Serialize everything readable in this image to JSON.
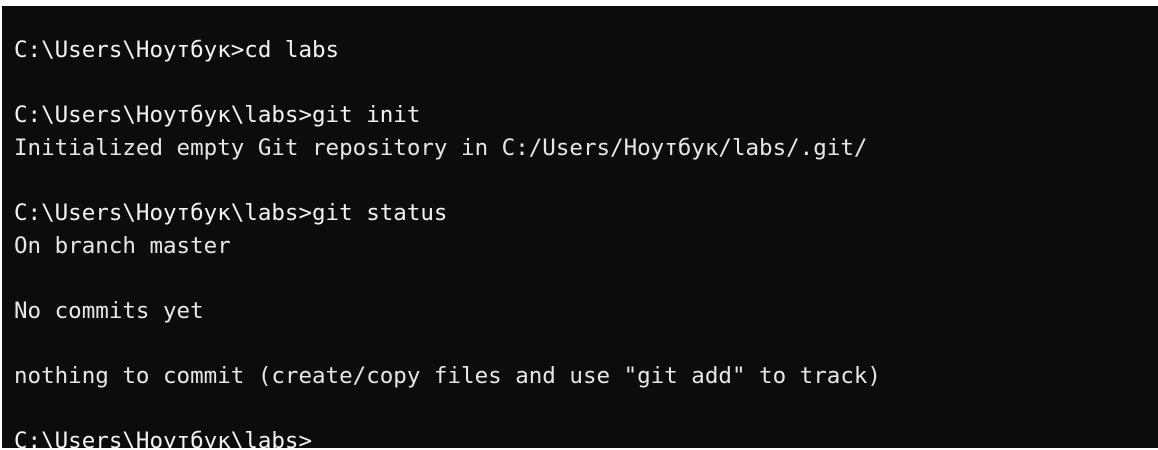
{
  "terminal": {
    "lines": [
      {
        "text": "C:\\Users\\Ноутбук>cd labs",
        "kind": "prompt"
      },
      {
        "text": "",
        "kind": "blank"
      },
      {
        "text": "C:\\Users\\Ноутбук\\labs>git init",
        "kind": "prompt"
      },
      {
        "text": "Initialized empty Git repository in C:/Users/Ноутбук/labs/.git/",
        "kind": "output"
      },
      {
        "text": "",
        "kind": "blank"
      },
      {
        "text": "C:\\Users\\Ноутбук\\labs>git status",
        "kind": "prompt"
      },
      {
        "text": "On branch master",
        "kind": "output"
      },
      {
        "text": "",
        "kind": "blank"
      },
      {
        "text": "No commits yet",
        "kind": "output"
      },
      {
        "text": "",
        "kind": "blank"
      },
      {
        "text": "nothing to commit (create/copy files and use \"git add\" to track)",
        "kind": "output"
      },
      {
        "text": "",
        "kind": "blank"
      },
      {
        "text": "C:\\Users\\Ноутбук\\labs>",
        "kind": "prompt"
      }
    ],
    "colors": {
      "background": "#0c0c0c",
      "text": "#e6e6e6"
    }
  }
}
